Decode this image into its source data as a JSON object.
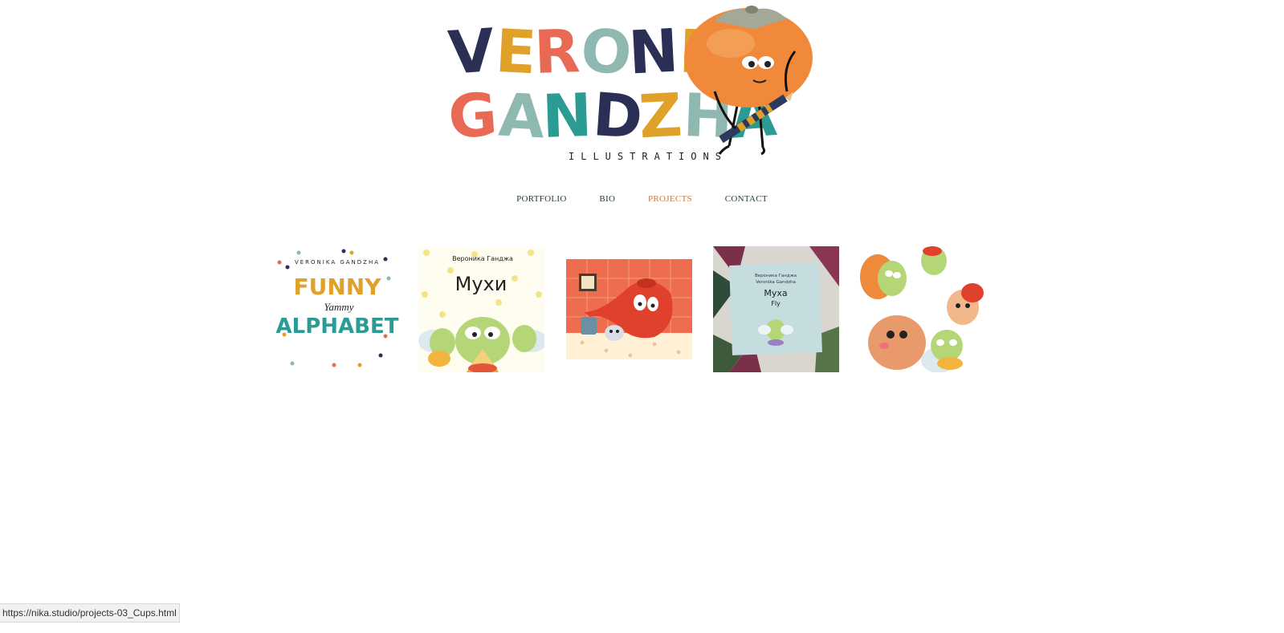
{
  "brand": {
    "name_line1": "VERONIKA",
    "name_line2": "GANDZHA",
    "subtitle": "ILLUSTRATIONS",
    "letter_colors_line1": [
      "#2b2f55",
      "#e0a12a",
      "#e86a55",
      "#8fb9b0",
      "#2b2f55",
      "#e0a12a",
      "#e86a55",
      "#e0a12a"
    ],
    "letter_colors_line2": [
      "#e86a55",
      "#8fb9b0",
      "#2b9b93",
      "#2b2f55",
      "#e0a12a",
      "#8fb9b0",
      "#2b9b93"
    ]
  },
  "nav": {
    "items": [
      {
        "label": "PORTFOLIO",
        "active": false
      },
      {
        "label": "BIO",
        "active": false
      },
      {
        "label": "PROJECTS",
        "active": true
      },
      {
        "label": "CONTACT",
        "active": false
      }
    ],
    "active_color": "#c9793a",
    "text_color": "#2a3c3e"
  },
  "projects": [
    {
      "cover_top": "VERONIKA GANDZHA",
      "cover_line1": "FUNNY",
      "cover_line2": "Yammy",
      "cover_line3": "ALPHABET"
    },
    {
      "cover_top": "Вероника Ганджа",
      "cover_title": "Мухи"
    },
    {
      "cover_title": ""
    },
    {
      "cover_top": "Вероника Ганджа",
      "cover_top2": "Veronika Gandzha",
      "cover_title": "Муха",
      "cover_subtitle": "Fly"
    },
    {
      "cover_title": ""
    }
  ],
  "status_bar": {
    "url": "https://nika.studio/projects-03_Cups.html"
  }
}
